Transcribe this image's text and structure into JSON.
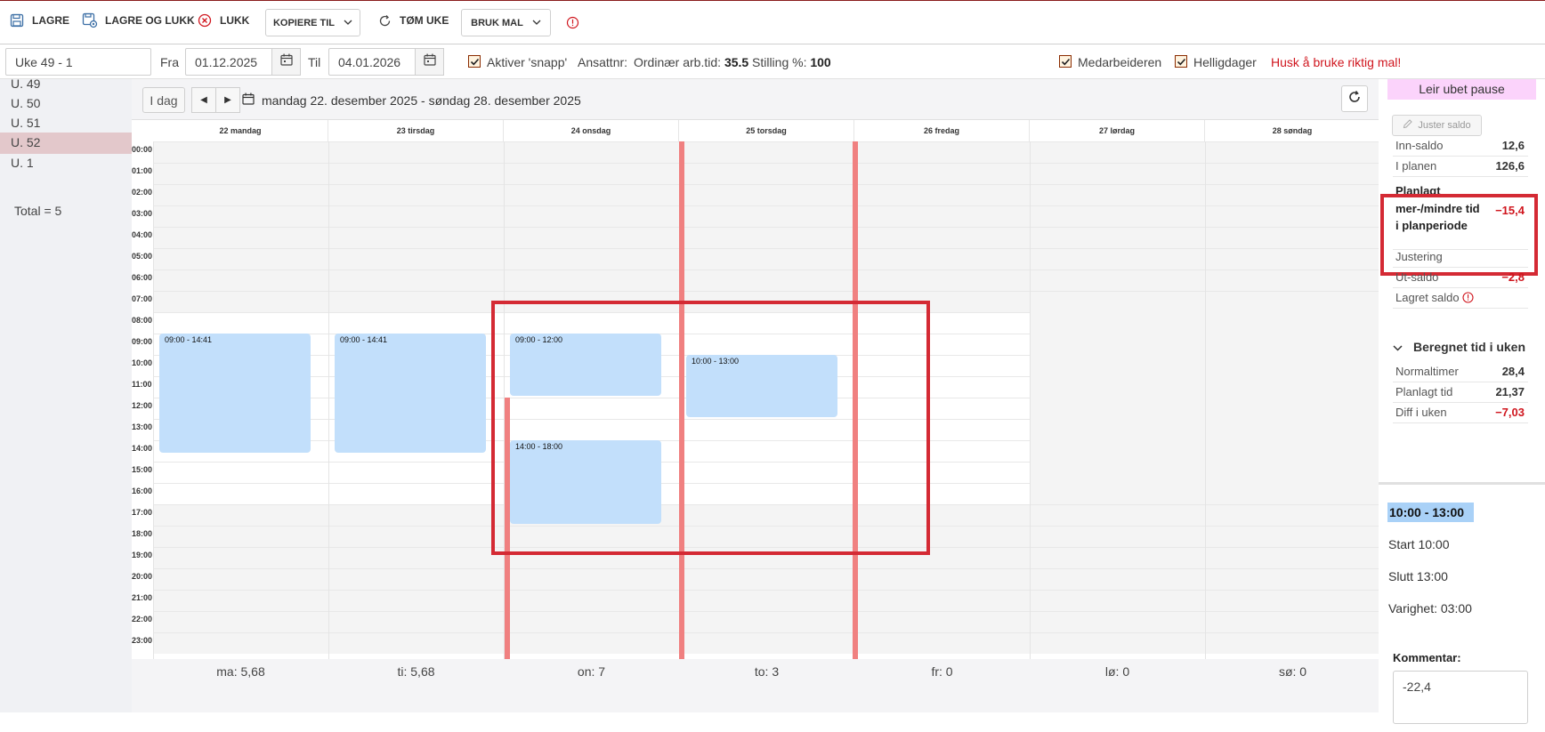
{
  "toolbar": {
    "save_label": "LAGRE",
    "save_close_label": "LAGRE OG LUKK",
    "close_label": "LUKK",
    "copy_label": "KOPIERE TIL",
    "clear_label": "TØM UKE",
    "template_label": "BRUK MAL"
  },
  "filter": {
    "week_select": "Uke 49 - 1",
    "from_label": "Fra",
    "from_value": "01.12.2025",
    "to_label": "Til",
    "to_value": "04.01.2026",
    "snap_label": "Aktiver 'snapp'",
    "employee_no_label": "Ansattnr:",
    "ordinary_label": "Ordinær arb.tid:",
    "ordinary_value": "35.5",
    "position_label": "Stilling %:",
    "position_value": "100",
    "employee_label": "Medarbeideren",
    "holidays_label": "Helligdager",
    "warning": "Husk å bruke riktig mal!"
  },
  "weeks": {
    "items": [
      "U. 49",
      "U. 50",
      "U. 51",
      "U. 52",
      "U. 1"
    ],
    "active_index": 3,
    "total": "Total = 5"
  },
  "calendar": {
    "today_label": "I dag",
    "range": "mandag 22. desember 2025 - søndag 28. desember 2025",
    "days": [
      "22 mandag",
      "23 tirsdag",
      "24 onsdag",
      "25 torsdag",
      "26 fredag",
      "27 lørdag",
      "28 søndag"
    ],
    "hours": [
      "00:00",
      "01:00",
      "02:00",
      "03:00",
      "04:00",
      "05:00",
      "06:00",
      "07:00",
      "08:00",
      "09:00",
      "10:00",
      "11:00",
      "12:00",
      "13:00",
      "14:00",
      "15:00",
      "16:00",
      "17:00",
      "18:00",
      "19:00",
      "20:00",
      "21:00",
      "22:00",
      "23:00"
    ],
    "events": [
      {
        "day": 0,
        "start": 9,
        "end": 14.68,
        "label": "09:00 - 14:41"
      },
      {
        "day": 1,
        "start": 9,
        "end": 14.68,
        "label": "09:00 - 14:41"
      },
      {
        "day": 2,
        "start": 9,
        "end": 12,
        "label": "09:00 - 12:00"
      },
      {
        "day": 2,
        "start": 14,
        "end": 18,
        "label": "14:00 - 18:00"
      },
      {
        "day": 3,
        "start": 10,
        "end": 13,
        "label": "10:00 - 13:00"
      }
    ],
    "sums": [
      "ma: 5,68",
      "ti: 5,68",
      "on: 7",
      "to: 3",
      "fr: 0",
      "lø: 0",
      "sø: 0"
    ]
  },
  "panel": {
    "leir": "Leir ubet pause",
    "adjust_label": "Juster saldo",
    "rows": {
      "inn_label": "Inn-saldo",
      "inn_value": "12,6",
      "plan_label": "I planen",
      "plan_value": "126,6",
      "planned_label": "Planlagt mer-/mindre tid i planperiode",
      "planned_value": "−15,4",
      "adj_label": "Justering",
      "out_label": "Ut-saldo",
      "out_value": "−2,8",
      "saved_label": "Lagret saldo"
    },
    "computed_title": "Beregnet tid i uken",
    "computed": {
      "normal_label": "Normaltimer",
      "normal_value": "28,4",
      "planned_label": "Planlagt tid",
      "planned_value": "21,37",
      "diff_label": "Diff i uken",
      "diff_value": "−7,03"
    },
    "selected": {
      "time": "10:00 - 13:00",
      "start": "Start 10:00",
      "end": "Slutt 13:00",
      "duration": "Varighet: 03:00"
    },
    "comment_label": "Kommentar:",
    "comment_value": "-22,4"
  },
  "colors": {
    "event": "#c2dffb",
    "holiday_bar": "#f08080",
    "highlight": "#d42a34",
    "negative": "#d0161e"
  }
}
